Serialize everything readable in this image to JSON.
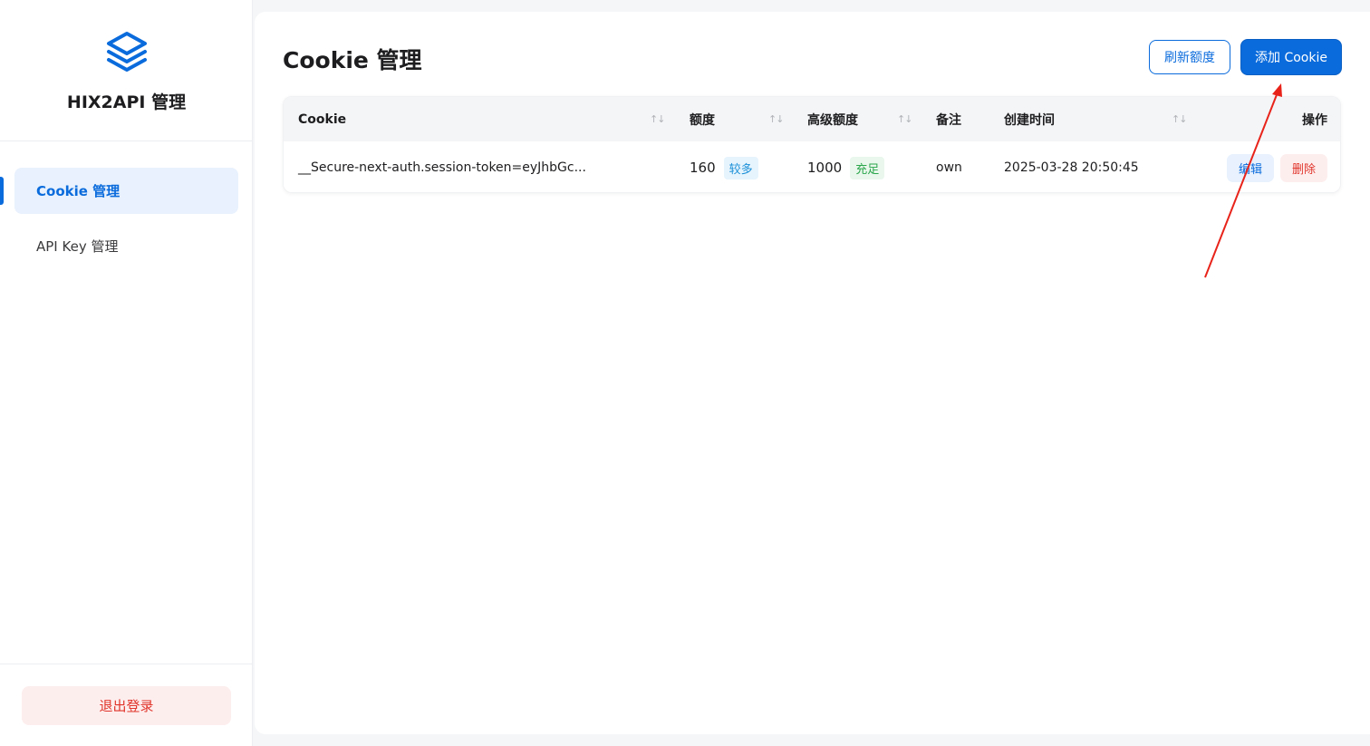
{
  "sidebar": {
    "brand_title": "HIX2API 管理",
    "items": [
      {
        "label": "Cookie 管理",
        "active": true
      },
      {
        "label": "API Key 管理",
        "active": false
      }
    ],
    "logout_label": "退出登录"
  },
  "main": {
    "title": "Cookie 管理",
    "refresh_label": "刷新额度",
    "add_label": "添加 Cookie",
    "table": {
      "columns": [
        "Cookie",
        "额度",
        "高级额度",
        "备注",
        "创建时间",
        "操作"
      ],
      "rows": [
        {
          "cookie": "__Secure-next-auth.session-token=eyJhbGc...",
          "quota": "160",
          "quota_tag": "较多",
          "premium_quota": "1000",
          "premium_tag": "充足",
          "note": "own",
          "created": "2025-03-28 20:50:45",
          "edit_label": "编辑",
          "delete_label": "删除"
        }
      ]
    }
  },
  "icons": {
    "brand": "layers-icon",
    "sort": "sort-arrows-icon",
    "sort_glyph": "↑↓"
  },
  "colors": {
    "accent": "#0a6bdc",
    "danger": "#e0352b",
    "annotation": "#e8231a"
  }
}
